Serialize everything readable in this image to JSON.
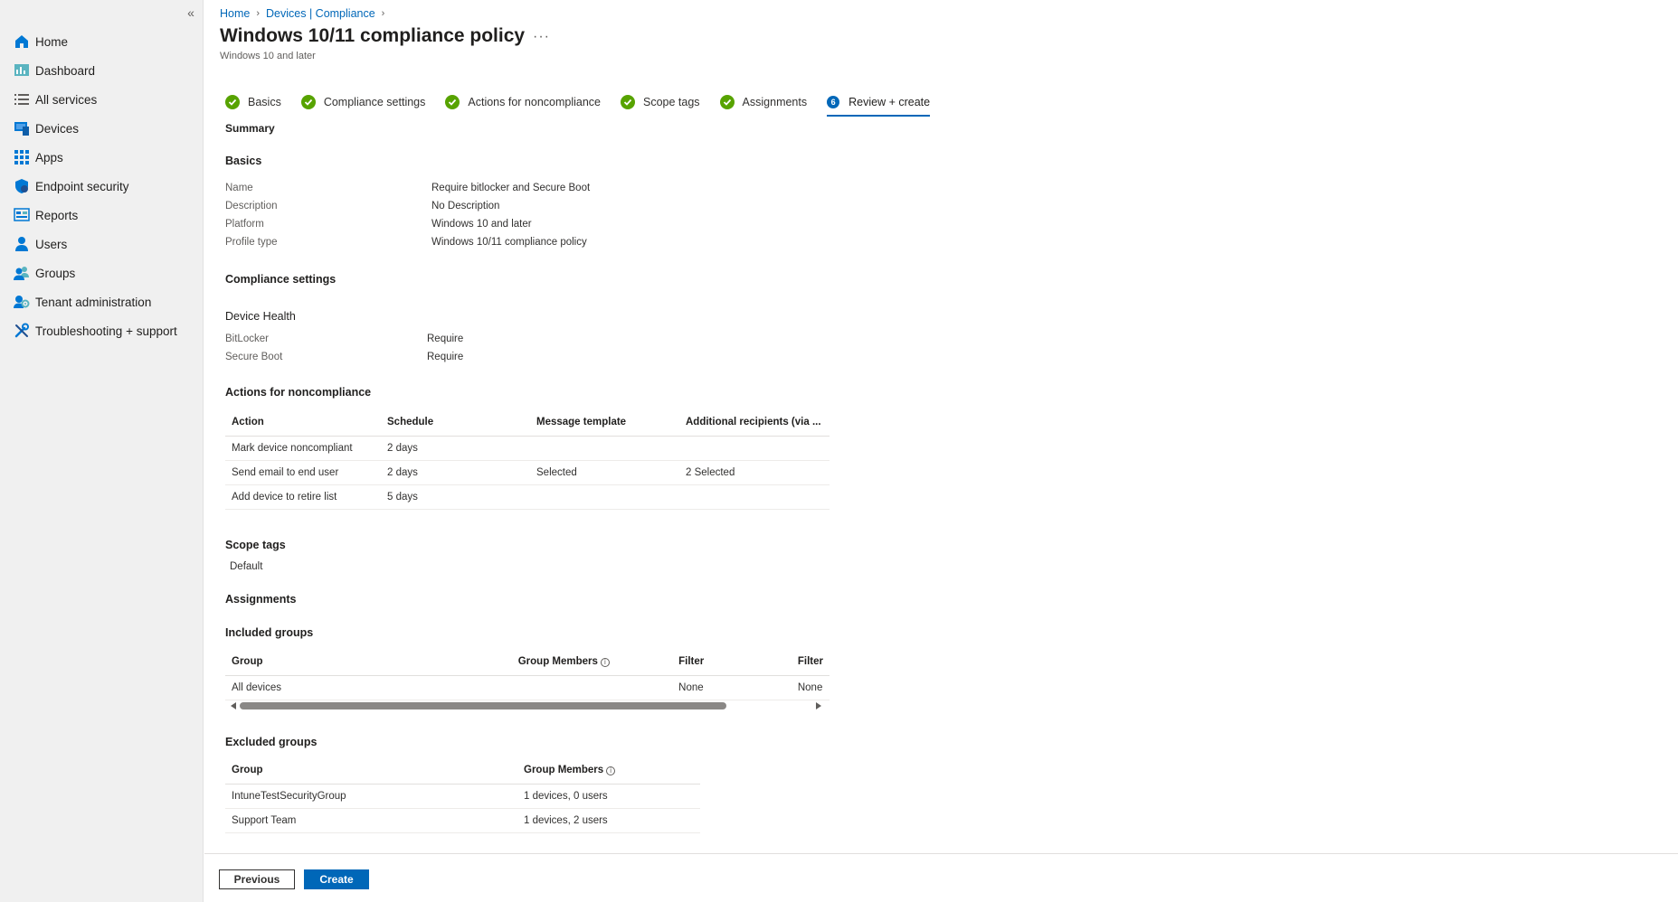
{
  "sidebar": {
    "collapse_label": "«",
    "items": [
      {
        "label": "Home",
        "icon": "home-icon"
      },
      {
        "label": "Dashboard",
        "icon": "dashboard-icon"
      },
      {
        "label": "All services",
        "icon": "list-icon"
      },
      {
        "label": "Devices",
        "icon": "devices-icon"
      },
      {
        "label": "Apps",
        "icon": "apps-icon"
      },
      {
        "label": "Endpoint security",
        "icon": "shield-icon"
      },
      {
        "label": "Reports",
        "icon": "reports-icon"
      },
      {
        "label": "Users",
        "icon": "user-icon"
      },
      {
        "label": "Groups",
        "icon": "groups-icon"
      },
      {
        "label": "Tenant administration",
        "icon": "tenant-admin-icon"
      },
      {
        "label": "Troubleshooting + support",
        "icon": "tools-icon"
      }
    ]
  },
  "breadcrumb": {
    "items": [
      "Home",
      "Devices | Compliance"
    ],
    "separator": "›"
  },
  "header": {
    "title": "Windows 10/11 compliance policy",
    "more": "···",
    "subtitle": "Windows 10 and later"
  },
  "steps": [
    {
      "label": "Basics",
      "status": "done"
    },
    {
      "label": "Compliance settings",
      "status": "done"
    },
    {
      "label": "Actions for noncompliance",
      "status": "done"
    },
    {
      "label": "Scope tags",
      "status": "done"
    },
    {
      "label": "Assignments",
      "status": "done"
    },
    {
      "label": "Review + create",
      "status": "active",
      "number": "6"
    }
  ],
  "summary": {
    "heading": "Summary",
    "basics": {
      "heading": "Basics",
      "rows": [
        {
          "key": "Name",
          "value": "Require bitlocker and Secure Boot"
        },
        {
          "key": "Description",
          "value": "No Description"
        },
        {
          "key": "Platform",
          "value": "Windows 10 and later"
        },
        {
          "key": "Profile type",
          "value": "Windows 10/11 compliance policy"
        }
      ]
    },
    "compliance": {
      "heading": "Compliance settings",
      "subheading": "Device Health",
      "rows": [
        {
          "key": "BitLocker",
          "value": "Require"
        },
        {
          "key": "Secure Boot",
          "value": "Require"
        }
      ]
    },
    "actions": {
      "heading": "Actions for noncompliance",
      "columns": [
        "Action",
        "Schedule",
        "Message template",
        "Additional recipients (via ..."
      ],
      "rows": [
        [
          "Mark device noncompliant",
          "2 days",
          "",
          ""
        ],
        [
          "Send email to end user",
          "2 days",
          "Selected",
          "2 Selected"
        ],
        [
          "Add device to retire list",
          "5 days",
          "",
          ""
        ]
      ]
    },
    "scope_tags": {
      "heading": "Scope tags",
      "value": "Default"
    },
    "assignments": {
      "heading": "Assignments",
      "included": {
        "heading": "Included groups",
        "columns": [
          "Group",
          "Group Members",
          "Filter",
          "Filter"
        ],
        "rows": [
          [
            "All devices",
            "",
            "None",
            "None"
          ]
        ]
      },
      "excluded": {
        "heading": "Excluded groups",
        "columns": [
          "Group",
          "Group Members"
        ],
        "rows": [
          [
            "IntuneTestSecurityGroup",
            "1 devices, 0 users"
          ],
          [
            "Support Team",
            "1 devices, 2 users"
          ]
        ]
      }
    }
  },
  "footer": {
    "previous_label": "Previous",
    "create_label": "Create"
  },
  "colors": {
    "accent": "#0067b8",
    "success": "#57a300",
    "sidebar_bg": "#f0f0f0"
  }
}
